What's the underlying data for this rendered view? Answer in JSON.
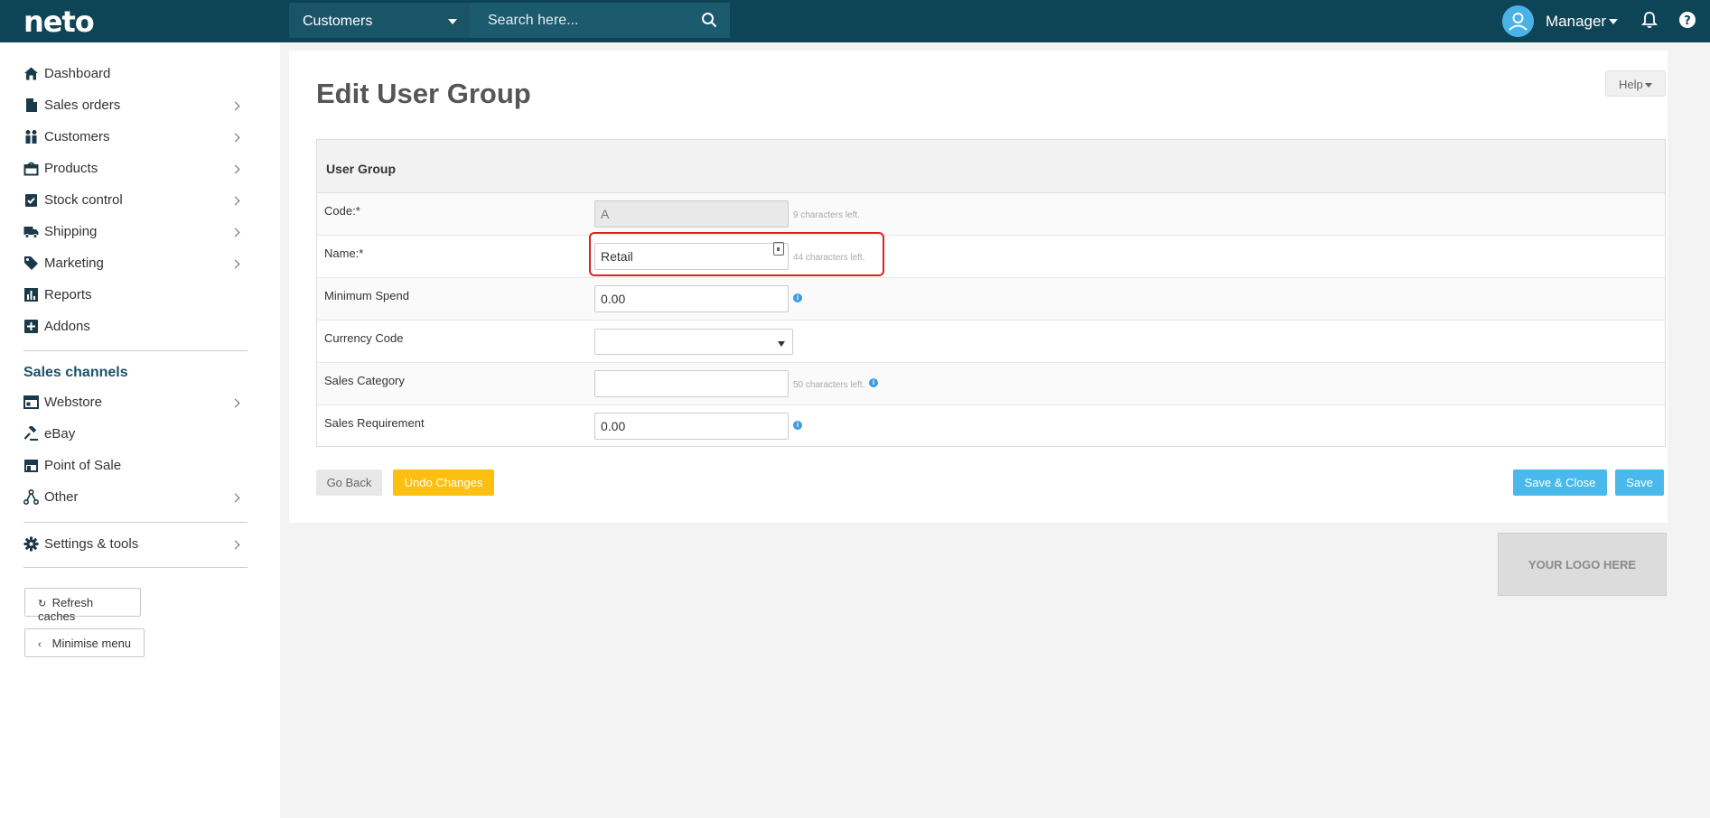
{
  "brand": {
    "logo": "neto"
  },
  "topbar": {
    "search_scope": "Customers",
    "search_placeholder": "Search here...",
    "user_name": "Manager"
  },
  "sidebar": {
    "items": [
      {
        "label": "Dashboard",
        "icon": "home-icon"
      },
      {
        "label": "Sales orders",
        "icon": "document-icon"
      },
      {
        "label": "Customers",
        "icon": "people-icon"
      },
      {
        "label": "Products",
        "icon": "box-icon"
      },
      {
        "label": "Stock control",
        "icon": "clipboard-check-icon"
      },
      {
        "label": "Shipping",
        "icon": "truck-icon"
      },
      {
        "label": "Marketing",
        "icon": "tag-icon"
      },
      {
        "label": "Reports",
        "icon": "bar-chart-icon"
      },
      {
        "label": "Addons",
        "icon": "plus-square-icon"
      }
    ],
    "channels_heading": "Sales channels",
    "channels": [
      {
        "label": "Webstore",
        "icon": "browser-icon"
      },
      {
        "label": "eBay",
        "icon": "gavel-icon"
      },
      {
        "label": "Point of Sale",
        "icon": "store-icon"
      },
      {
        "label": "Other",
        "icon": "share-nodes-icon"
      }
    ],
    "settings_label": "Settings & tools",
    "refresh_label": "Refresh caches",
    "minimise_label": "Minimise menu"
  },
  "page": {
    "title": "Edit User Group",
    "help_label": "Help"
  },
  "form": {
    "section_title": "User Group",
    "code": {
      "label": "Code:*",
      "value": "A",
      "hint": "9 characters left."
    },
    "name": {
      "label": "Name:*",
      "value": "Retail",
      "hint": "44 characters left."
    },
    "min_spend": {
      "label": "Minimum Spend",
      "value": "0.00"
    },
    "currency": {
      "label": "Currency Code",
      "value": ""
    },
    "sales_category": {
      "label": "Sales Category",
      "value": "",
      "hint": "50 characters left."
    },
    "sales_requirement": {
      "label": "Sales Requirement",
      "value": "0.00"
    }
  },
  "actions": {
    "back": "Go Back",
    "undo": "Undo Changes",
    "save_close": "Save & Close",
    "save": "Save"
  },
  "logo_placeholder": "YOUR LOGO HERE",
  "colors": {
    "topbar": "#0d4456",
    "accent_blue": "#49b9ec",
    "accent_yellow": "#fdc010",
    "highlight_red": "#e02020"
  }
}
